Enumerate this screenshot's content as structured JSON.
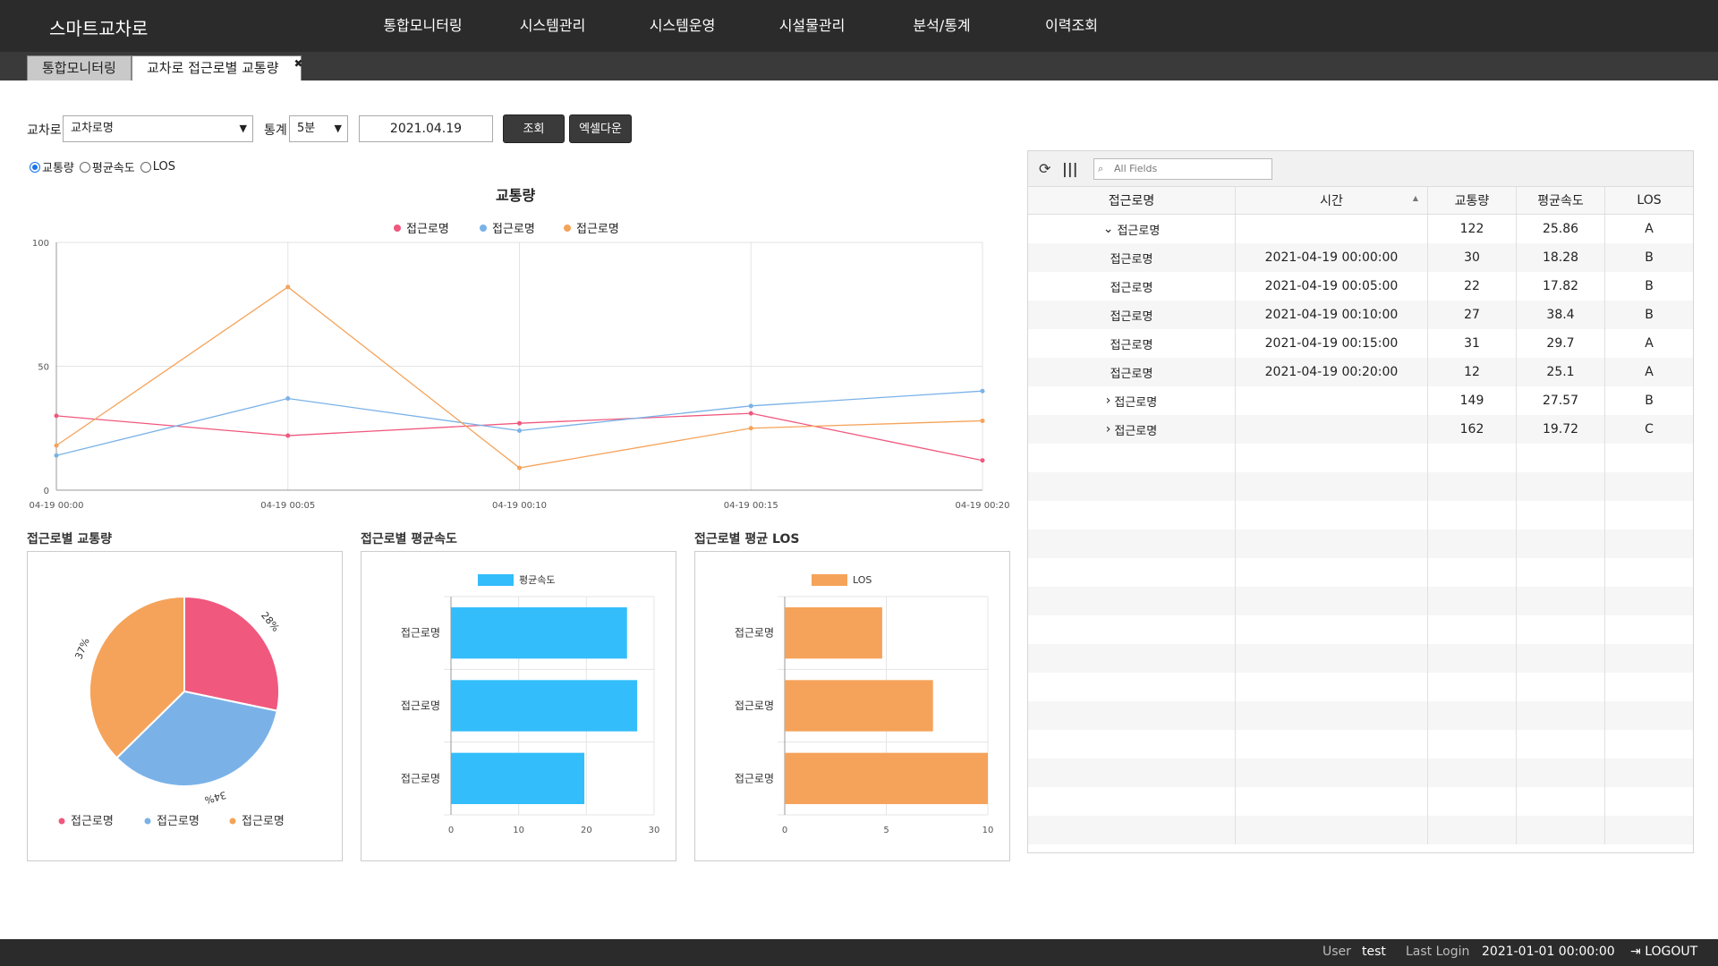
{
  "app": {
    "brand": "스마트교차로"
  },
  "nav": [
    "통합모니터링",
    "시스템관리",
    "시스템운영",
    "시설물관리",
    "분석/통계",
    "이력조회"
  ],
  "tabs": [
    {
      "label": "통합모니터링",
      "active": false
    },
    {
      "label": "교차로 접근로별 교통량",
      "active": true,
      "close": "✖"
    }
  ],
  "filters": {
    "intersection_label": "교차로",
    "intersection_value": "교차로명",
    "stat_label": "통계",
    "stat_value": "5분",
    "date": "2021.04.19",
    "search_btn": "조회",
    "excel_btn": "엑셀다운"
  },
  "radios": [
    {
      "label": "교통량",
      "checked": true
    },
    {
      "label": "평균속도",
      "checked": false
    },
    {
      "label": "LOS",
      "checked": false
    }
  ],
  "colors": {
    "pink": "#f0587e",
    "blue": "#7ab2e8",
    "orange": "#f5a35a",
    "cyan": "#33bdfb"
  },
  "chart_data": [
    {
      "type": "line",
      "title": "교통량",
      "x": [
        "04-19 00:00",
        "04-19 00:05",
        "04-19 00:10",
        "04-19 00:15",
        "04-19 00:20"
      ],
      "ylim": [
        0,
        100
      ],
      "yticks": [
        "0",
        "50",
        "100"
      ],
      "grid": true,
      "legend": "top-center",
      "series": [
        {
          "name": "접근로명",
          "color": "#f0587e",
          "values": [
            30,
            22,
            27,
            31,
            12
          ]
        },
        {
          "name": "접근로명",
          "color": "#7ab2e8",
          "values": [
            14,
            37,
            24,
            34,
            40
          ]
        },
        {
          "name": "접근로명",
          "color": "#f5a35a",
          "values": [
            18,
            82,
            9,
            25,
            28
          ]
        }
      ]
    },
    {
      "type": "pie",
      "title": "접근로별 교통량",
      "slices": [
        {
          "name": "접근로명",
          "value": 28,
          "label": "28%",
          "color": "#f0587e"
        },
        {
          "name": "접근로명",
          "value": 34,
          "label": "34%",
          "color": "#7ab2e8"
        },
        {
          "name": "접근로명",
          "value": 37,
          "label": "37%",
          "color": "#f5a35a"
        }
      ],
      "legend": "bottom"
    },
    {
      "type": "bar",
      "title": "접근로별 평균속도",
      "orientation": "horizontal",
      "series_name": "평균속도",
      "color": "#33bdfb",
      "categories": [
        "접근로명",
        "접근로명",
        "접근로명"
      ],
      "values": [
        26,
        27.5,
        19.7
      ],
      "xlim": [
        0,
        30
      ],
      "xticks": [
        "0",
        "10",
        "20",
        "30"
      ]
    },
    {
      "type": "bar",
      "title": "접근로별 평균 LOS",
      "orientation": "horizontal",
      "series_name": "LOS",
      "color": "#f5a35a",
      "categories": [
        "접근로명",
        "접근로명",
        "접근로명"
      ],
      "values": [
        4.8,
        7.3,
        10
      ],
      "xlim": [
        0,
        10
      ],
      "xticks": [
        "0",
        "5",
        "10"
      ]
    }
  ],
  "grid": {
    "filter_placeholder": "All Fields",
    "columns": [
      "접근로명",
      "시간",
      "교통량",
      "평균속도",
      "LOS"
    ],
    "rows": [
      {
        "name": "접근로명",
        "group": "expanded",
        "time": "",
        "volume": "122",
        "speed": "25.86",
        "los": "A"
      },
      {
        "name": "접근로명",
        "group": "",
        "time": "2021-04-19 00:00:00",
        "volume": "30",
        "speed": "18.28",
        "los": "B"
      },
      {
        "name": "접근로명",
        "group": "",
        "time": "2021-04-19 00:05:00",
        "volume": "22",
        "speed": "17.82",
        "los": "B"
      },
      {
        "name": "접근로명",
        "group": "",
        "time": "2021-04-19 00:10:00",
        "volume": "27",
        "speed": "38.4",
        "los": "B"
      },
      {
        "name": "접근로명",
        "group": "",
        "time": "2021-04-19 00:15:00",
        "volume": "31",
        "speed": "29.7",
        "los": "A"
      },
      {
        "name": "접근로명",
        "group": "",
        "time": "2021-04-19 00:20:00",
        "volume": "12",
        "speed": "25.1",
        "los": "A"
      },
      {
        "name": "접근로명",
        "group": "collapsed",
        "time": "",
        "volume": "149",
        "speed": "27.57",
        "los": "B"
      },
      {
        "name": "접근로명",
        "group": "collapsed",
        "time": "",
        "volume": "162",
        "speed": "19.72",
        "los": "C"
      }
    ]
  },
  "footer": {
    "user_label": "User",
    "user_value": "test",
    "login_label": "Last Login",
    "login_value": "2021-01-01 00:00:00",
    "logout": "LOGOUT"
  }
}
